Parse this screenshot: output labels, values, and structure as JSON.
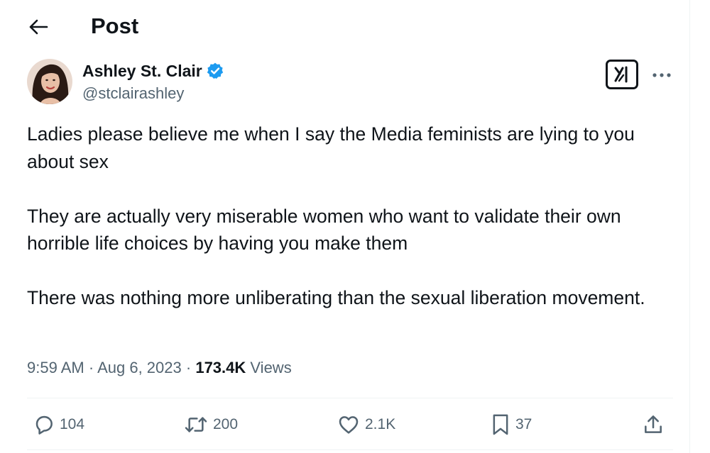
{
  "header": {
    "title": "Post",
    "back_icon": "arrow-left-icon"
  },
  "author": {
    "display_name": "Ashley St. Clair",
    "handle": "@stclairashley",
    "verified": true,
    "verified_color": "#1d9bf0"
  },
  "post": {
    "paragraphs": [
      "Ladies please believe me when I say the Media feminists are lying to you about sex",
      "They are actually very miserable women who want to validate their own horrible life choices by having you make them",
      "There was nothing more unliberating than the sexual liberation movement."
    ],
    "time": "9:59 AM",
    "separator": "·",
    "date": "Aug 6, 2023",
    "views_count": "173.4K",
    "views_label": "Views"
  },
  "actions": {
    "replies": "104",
    "reposts": "200",
    "likes": "2.1K",
    "bookmarks": "37"
  },
  "colors": {
    "text_primary": "#0f1419",
    "text_secondary": "#536471",
    "divider": "#eff3f4",
    "accent": "#1d9bf0"
  }
}
